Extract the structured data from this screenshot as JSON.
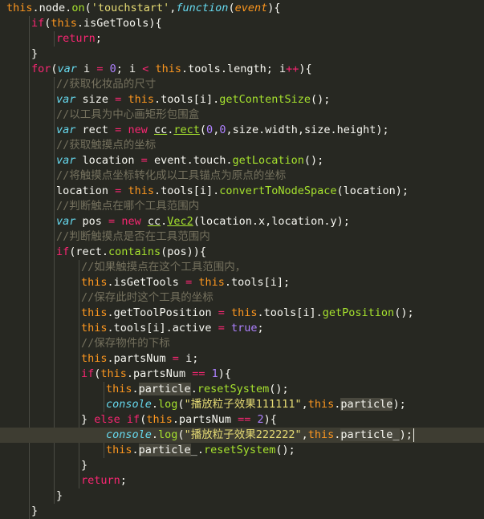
{
  "editor": {
    "colors": {
      "background": "#272822",
      "current_line": "#3e3d32",
      "keyword": "#f92672",
      "this": "#fd971f",
      "function": "#a6e22e",
      "declaration": "#66d9ef",
      "string": "#e6db74",
      "number": "#ae81ff",
      "comment": "#75715e",
      "plain": "#f8f8f2"
    },
    "active_line": 28,
    "lines": [
      {
        "indent": 1,
        "tokens": [
          [
            "this",
            "this"
          ],
          [
            "plain",
            "."
          ],
          [
            "plain",
            "node"
          ],
          [
            "plain",
            "."
          ],
          [
            "fn",
            "on"
          ],
          [
            "plain",
            "("
          ],
          [
            "str",
            "'touchstart'"
          ],
          [
            "plain",
            ","
          ],
          [
            "dec",
            "function"
          ],
          [
            "plain",
            "("
          ],
          [
            "param",
            "event"
          ],
          [
            "plain",
            ")"
          ],
          [
            "plain",
            "{"
          ]
        ]
      },
      {
        "indent": 2,
        "tokens": [
          [
            "kw",
            "if"
          ],
          [
            "plain",
            "("
          ],
          [
            "this",
            "this"
          ],
          [
            "plain",
            ".isGetTools){"
          ]
        ]
      },
      {
        "indent": 3,
        "tokens": [
          [
            "kw",
            "return"
          ],
          [
            "plain",
            ";"
          ]
        ]
      },
      {
        "indent": 2,
        "tokens": [
          [
            "plain",
            "}"
          ]
        ]
      },
      {
        "indent": 2,
        "tokens": [
          [
            "kw",
            "for"
          ],
          [
            "plain",
            "("
          ],
          [
            "dec",
            "var"
          ],
          [
            "plain",
            " i "
          ],
          [
            "kw",
            "="
          ],
          [
            "plain",
            " "
          ],
          [
            "num",
            "0"
          ],
          [
            "plain",
            "; i "
          ],
          [
            "kw",
            "<"
          ],
          [
            "plain",
            " "
          ],
          [
            "this",
            "this"
          ],
          [
            "plain",
            ".tools.length; i"
          ],
          [
            "kw",
            "++"
          ],
          [
            "plain",
            "){"
          ]
        ]
      },
      {
        "indent": 3,
        "tokens": [
          [
            "cmt",
            "//获取化妆品的尺寸"
          ]
        ]
      },
      {
        "indent": 3,
        "tokens": [
          [
            "dec",
            "var"
          ],
          [
            "plain",
            " size "
          ],
          [
            "kw",
            "="
          ],
          [
            "plain",
            " "
          ],
          [
            "this",
            "this"
          ],
          [
            "plain",
            ".tools[i]."
          ],
          [
            "fn",
            "getContentSize"
          ],
          [
            "plain",
            "();"
          ]
        ]
      },
      {
        "indent": 3,
        "tokens": [
          [
            "cmt",
            "//以工具为中心画矩形包围盒"
          ]
        ]
      },
      {
        "indent": 3,
        "tokens": [
          [
            "dec",
            "var"
          ],
          [
            "plain",
            " rect "
          ],
          [
            "kw",
            "="
          ],
          [
            "plain",
            " "
          ],
          [
            "kw",
            "new"
          ],
          [
            "plain",
            " "
          ],
          [
            "ul",
            "cc"
          ],
          [
            "plain",
            "."
          ],
          [
            "fnul",
            "rect"
          ],
          [
            "plain",
            "("
          ],
          [
            "num",
            "0"
          ],
          [
            "plain",
            ","
          ],
          [
            "num",
            "0"
          ],
          [
            "plain",
            ",size.width,size.height);"
          ]
        ]
      },
      {
        "indent": 3,
        "tokens": [
          [
            "cmt",
            "//获取触摸点的坐标"
          ]
        ]
      },
      {
        "indent": 3,
        "tokens": [
          [
            "dec",
            "var"
          ],
          [
            "plain",
            " location "
          ],
          [
            "kw",
            "="
          ],
          [
            "plain",
            " event.touch."
          ],
          [
            "fn",
            "getLocation"
          ],
          [
            "plain",
            "();"
          ]
        ]
      },
      {
        "indent": 3,
        "tokens": [
          [
            "cmt",
            "//将触摸点坐标转化成以工具锚点为原点的坐标"
          ]
        ]
      },
      {
        "indent": 3,
        "tokens": [
          [
            "plain",
            "location "
          ],
          [
            "kw",
            "="
          ],
          [
            "plain",
            " "
          ],
          [
            "this",
            "this"
          ],
          [
            "plain",
            ".tools[i]."
          ],
          [
            "fn",
            "convertToNodeSpace"
          ],
          [
            "plain",
            "(location);"
          ]
        ]
      },
      {
        "indent": 3,
        "tokens": [
          [
            "cmt",
            "//判断触点在哪个工具范围内"
          ]
        ]
      },
      {
        "indent": 3,
        "tokens": [
          [
            "dec",
            "var"
          ],
          [
            "plain",
            " pos "
          ],
          [
            "kw",
            "="
          ],
          [
            "plain",
            " "
          ],
          [
            "kw",
            "new"
          ],
          [
            "plain",
            " "
          ],
          [
            "ul",
            "cc"
          ],
          [
            "plain",
            "."
          ],
          [
            "fnul",
            "Vec2"
          ],
          [
            "plain",
            "(location.x,location.y);"
          ]
        ]
      },
      {
        "indent": 3,
        "tokens": [
          [
            "cmt",
            "//判断触摸点是否在工具范围内"
          ]
        ]
      },
      {
        "indent": 3,
        "tokens": [
          [
            "kw",
            "if"
          ],
          [
            "plain",
            "(rect."
          ],
          [
            "fn",
            "contains"
          ],
          [
            "plain",
            "(pos)){"
          ]
        ]
      },
      {
        "indent": 4,
        "tokens": [
          [
            "cmt",
            "//如果触摸点在这个工具范围内，"
          ]
        ]
      },
      {
        "indent": 4,
        "tokens": [
          [
            "this",
            "this"
          ],
          [
            "plain",
            ".isGetTools "
          ],
          [
            "kw",
            "="
          ],
          [
            "plain",
            " "
          ],
          [
            "this",
            "this"
          ],
          [
            "plain",
            ".tools[i];"
          ]
        ]
      },
      {
        "indent": 4,
        "tokens": [
          [
            "cmt",
            "//保存此时这个工具的坐标"
          ]
        ]
      },
      {
        "indent": 4,
        "tokens": [
          [
            "this",
            "this"
          ],
          [
            "plain",
            "."
          ],
          [
            "plain",
            "getToolPosition "
          ],
          [
            "kw",
            "="
          ],
          [
            "plain",
            " "
          ],
          [
            "this",
            "this"
          ],
          [
            "plain",
            ".tools[i]."
          ],
          [
            "fn",
            "getPosition"
          ],
          [
            "plain",
            "();"
          ]
        ]
      },
      {
        "indent": 4,
        "tokens": [
          [
            "this",
            "this"
          ],
          [
            "plain",
            ".tools[i].active "
          ],
          [
            "kw",
            "="
          ],
          [
            "plain",
            " "
          ],
          [
            "num",
            "true"
          ],
          [
            "plain",
            ";"
          ]
        ]
      },
      {
        "indent": 4,
        "tokens": [
          [
            "cmt",
            "//保存物件的下标"
          ]
        ]
      },
      {
        "indent": 4,
        "tokens": [
          [
            "this",
            "this"
          ],
          [
            "plain",
            ".partsNum "
          ],
          [
            "kw",
            "="
          ],
          [
            "plain",
            " i;"
          ]
        ]
      },
      {
        "indent": 4,
        "tokens": [
          [
            "kw",
            "if"
          ],
          [
            "plain",
            "("
          ],
          [
            "this",
            "this"
          ],
          [
            "plain",
            ".partsNum "
          ],
          [
            "kw",
            "=="
          ],
          [
            "plain",
            " "
          ],
          [
            "num",
            "1"
          ],
          [
            "plain",
            "){"
          ]
        ]
      },
      {
        "indent": 5,
        "tokens": [
          [
            "this",
            "this"
          ],
          [
            "plain",
            "."
          ],
          [
            "hl",
            "particle"
          ],
          [
            "plain",
            "."
          ],
          [
            "fn",
            "resetSystem"
          ],
          [
            "plain",
            "();"
          ]
        ]
      },
      {
        "indent": 5,
        "tokens": [
          [
            "dec",
            "console"
          ],
          [
            "plain",
            "."
          ],
          [
            "fn",
            "log"
          ],
          [
            "plain",
            "("
          ],
          [
            "str",
            "\"播放粒子效果111111\""
          ],
          [
            "plain",
            ","
          ],
          [
            "this",
            "this"
          ],
          [
            "plain",
            "."
          ],
          [
            "hl",
            "particle"
          ],
          [
            "plain",
            ");"
          ]
        ]
      },
      {
        "indent": 4,
        "tokens": [
          [
            "plain",
            "} "
          ],
          [
            "kw",
            "else"
          ],
          [
            "plain",
            " "
          ],
          [
            "kw",
            "if"
          ],
          [
            "plain",
            "("
          ],
          [
            "this",
            "this"
          ],
          [
            "plain",
            ".partsNum "
          ],
          [
            "kw",
            "=="
          ],
          [
            "plain",
            " "
          ],
          [
            "num",
            "2"
          ],
          [
            "plain",
            "){"
          ]
        ]
      },
      {
        "indent": 5,
        "tokens": [
          [
            "dec",
            "console"
          ],
          [
            "plain",
            "."
          ],
          [
            "fn",
            "log"
          ],
          [
            "plain",
            "("
          ],
          [
            "str",
            "\"播放粒子效果222222\""
          ],
          [
            "plain",
            ","
          ],
          [
            "this",
            "this"
          ],
          [
            "plain",
            "."
          ],
          [
            "hl",
            "particle_"
          ],
          [
            "plain",
            ");"
          ]
        ]
      },
      {
        "indent": 5,
        "tokens": [
          [
            "this",
            "this"
          ],
          [
            "plain",
            "."
          ],
          [
            "hl",
            "particle"
          ],
          [
            "plain",
            "_."
          ],
          [
            "fn",
            "resetSystem"
          ],
          [
            "plain",
            "();"
          ]
        ]
      },
      {
        "indent": 4,
        "tokens": [
          [
            "plain",
            "}"
          ]
        ]
      },
      {
        "indent": 4,
        "tokens": [
          [
            "kw",
            "return"
          ],
          [
            "plain",
            ";"
          ]
        ]
      },
      {
        "indent": 3,
        "tokens": [
          [
            "plain",
            "}"
          ]
        ]
      },
      {
        "indent": 2,
        "tokens": [
          [
            "plain",
            "}"
          ]
        ]
      }
    ]
  }
}
